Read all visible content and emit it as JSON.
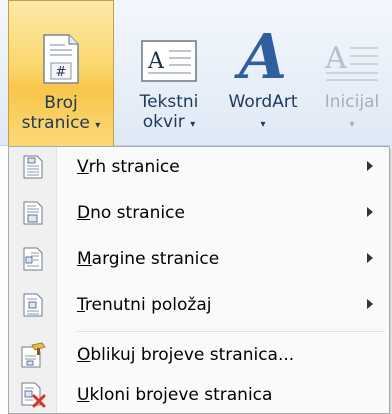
{
  "ribbon": {
    "broj": {
      "line1": "Broj",
      "line2": "stranice",
      "caret": "▾"
    },
    "tekstni": {
      "line1": "Tekstni",
      "line2": "okvir",
      "caret": "▾"
    },
    "wordart": {
      "line1": "WordArt",
      "caret": "▾"
    },
    "inicijal": {
      "line1": "Inicijal",
      "caret": "▾"
    },
    "wordart_glyph": "A",
    "textbox_glyph": "A",
    "page_glyph": "#"
  },
  "menu": {
    "items": [
      {
        "first": "V",
        "rest": "rh stranice",
        "icon": "page-top-icon"
      },
      {
        "first": "D",
        "rest": "no stranice",
        "icon": "page-bottom-icon"
      },
      {
        "first": "M",
        "rest": "argine stranice",
        "icon": "page-margins-icon"
      },
      {
        "first": "T",
        "rest": "renutni položaj",
        "icon": "current-position-icon"
      },
      {
        "first": "O",
        "rest": "blikuj brojeve stranica...",
        "icon": "format-page-numbers-icon"
      },
      {
        "first": "U",
        "rest": "kloni brojeve stranica",
        "icon": "remove-page-numbers-icon"
      }
    ]
  }
}
